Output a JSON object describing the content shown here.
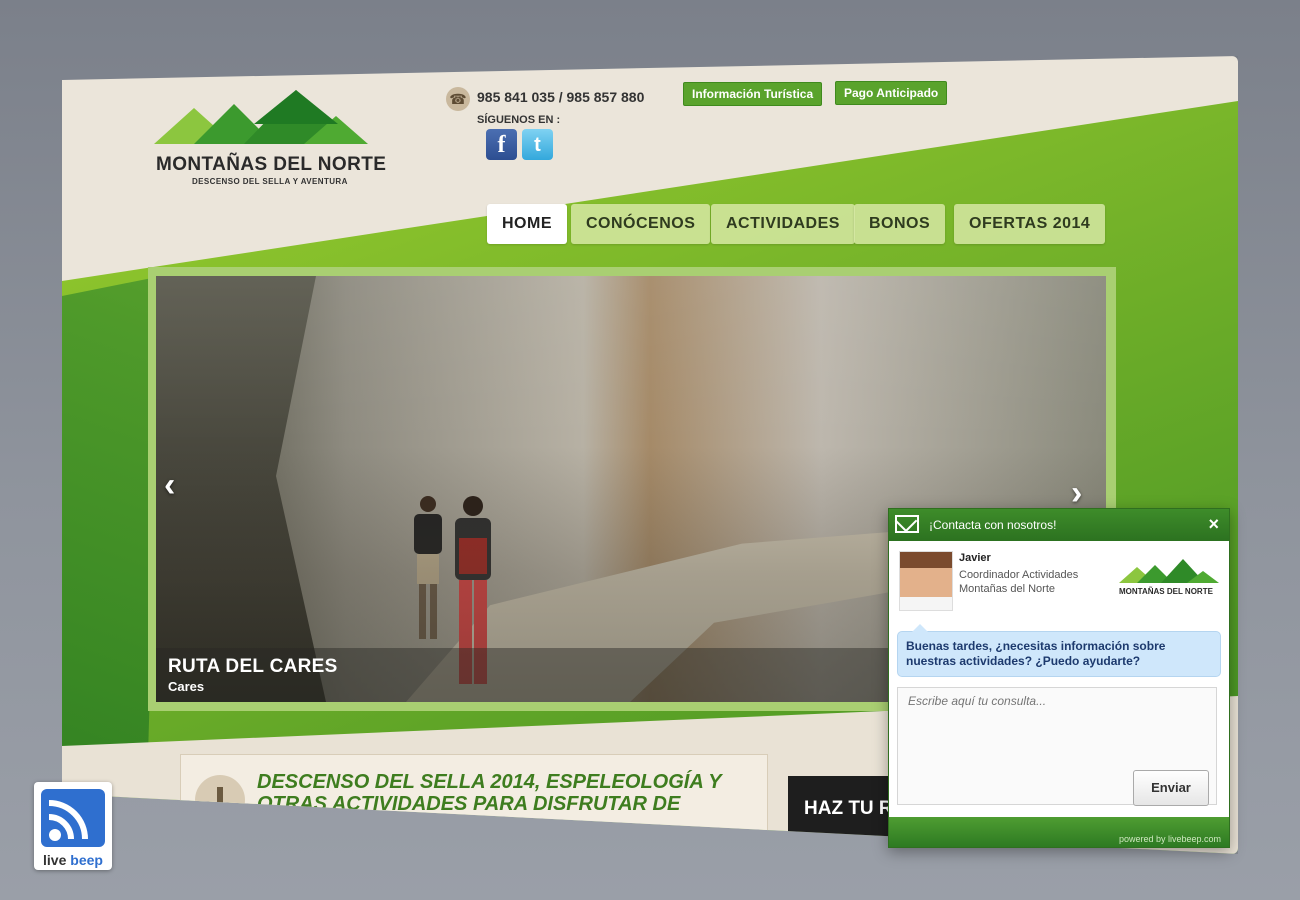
{
  "site": {
    "logo_title": "MONTAÑAS DEL NORTE",
    "logo_subtitle": "DESCENSO DEL SELLA Y AVENTURA",
    "phone": "985 841 035 / 985 857 880",
    "follow_label": "SÍGUENOS EN :",
    "social": {
      "facebook": "f",
      "twitter": "t"
    },
    "top_buttons": [
      "Información Turística",
      "Pago Anticipado"
    ],
    "nav": [
      "HOME",
      "CONÓCENOS",
      "ACTIVIDADES",
      "BONOS",
      "OFERTAS 2014"
    ],
    "nav_active": "HOME"
  },
  "slider": {
    "title": "RUTA DEL CARES",
    "subtitle": "Cares",
    "prev_icon": "chevron-left-icon",
    "next_icon": "chevron-right-icon"
  },
  "content": {
    "headline": "DESCENSO DEL SELLA 2014, ESPELEOLOGÍA Y OTRAS ACTIVIDADES PARA DISFRUTAR DE",
    "cta": "HAZ TU R"
  },
  "chat": {
    "header_title": "¡Contacta con nosotros!",
    "agent_name": "Javier",
    "agent_role": "Coordinador Actividades",
    "agent_company": "Montañas del Norte",
    "logo_title": "MONTAÑAS DEL NORTE",
    "message": "Buenas tardes, ¿necesitas información sobre nuestras actividades? ¿Puedo ayudarte?",
    "input_placeholder": "Escribe aquí tu consulta...",
    "send_label": "Enviar",
    "powered": "powered by livebeep.com"
  },
  "badge": {
    "live": "live",
    "beep": "beep"
  },
  "colors": {
    "brand_green": "#5aa32c",
    "dark_green": "#2c7220",
    "chat_bubble": "#cfe7fb",
    "livebeep_blue": "#2f6fcf"
  }
}
